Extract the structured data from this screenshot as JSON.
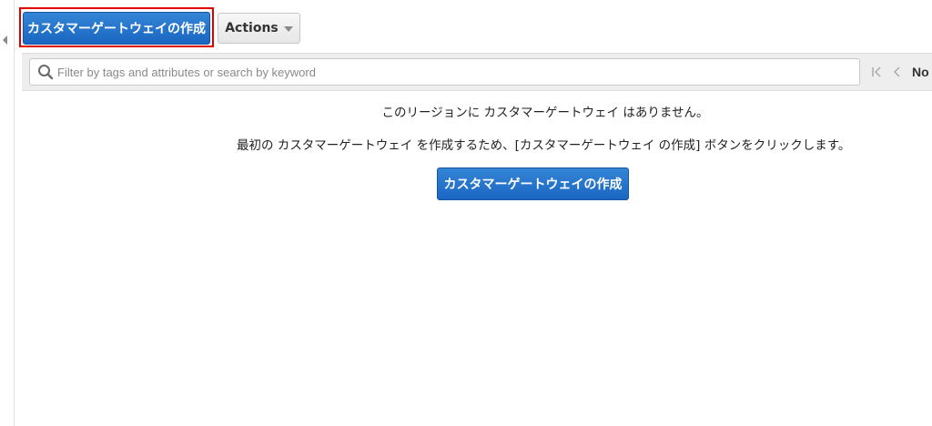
{
  "header": {
    "create_button_label": "カスタマーゲートウェイの作成",
    "actions_label": "Actions"
  },
  "search": {
    "placeholder": "Filter by tags and attributes or search by keyword",
    "value": ""
  },
  "pagination": {
    "text": "No"
  },
  "empty_state": {
    "message_line1": "このリージョンに カスタマーゲートウェイ はありません。",
    "message_line2": "最初の カスタマーゲートウェイ を作成するため、[カスタマーゲートウェイ の作成] ボタンをクリックします。",
    "create_button_label": "カスタマーゲートウェイの作成"
  },
  "colors": {
    "primary_button": "#1a66c2",
    "highlight": "#e00000",
    "toolbar_bg": "#eeeeee"
  },
  "icons": {
    "search": "search-icon",
    "first_page": "first-page-icon",
    "prev_page": "prev-page-icon",
    "collapse": "collapse-left-icon",
    "dropdown": "chevron-down-icon"
  }
}
